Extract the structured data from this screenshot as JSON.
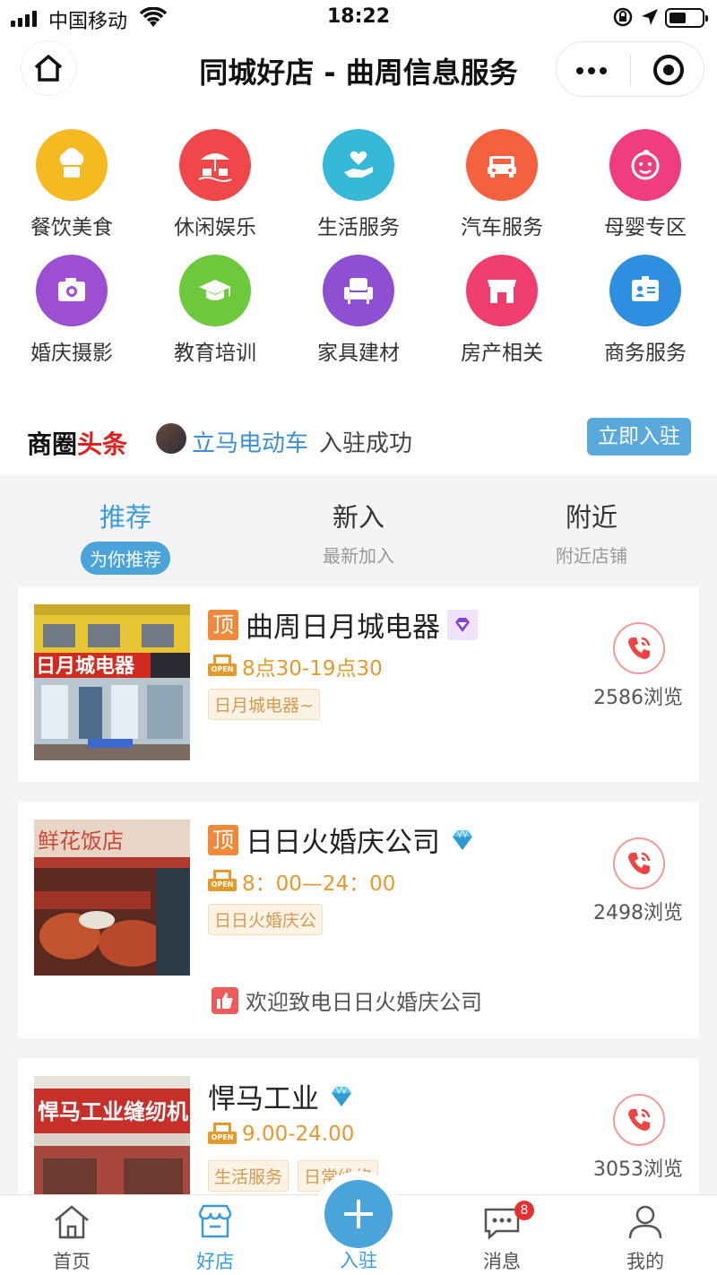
{
  "status_bar": {
    "carrier": "中国移动",
    "time": "18:22"
  },
  "nav": {
    "title": "同城好店 - 曲周信息服务"
  },
  "categories": [
    {
      "label": "餐饮美食",
      "icon": "chef-hat-icon",
      "color": "#f5b921"
    },
    {
      "label": "休闲娱乐",
      "icon": "beach-umbrella-icon",
      "color": "#f0474b"
    },
    {
      "label": "生活服务",
      "icon": "heart-hand-icon",
      "color": "#36b8d8"
    },
    {
      "label": "汽车服务",
      "icon": "car-icon",
      "color": "#f5603e"
    },
    {
      "label": "母婴专区",
      "icon": "baby-face-icon",
      "color": "#ef3d7d"
    },
    {
      "label": "婚庆摄影",
      "icon": "camera-icon",
      "color": "#9c4fd0"
    },
    {
      "label": "教育培训",
      "icon": "graduation-cap-icon",
      "color": "#6cc93b"
    },
    {
      "label": "家具建材",
      "icon": "armchair-icon",
      "color": "#8e4fd0"
    },
    {
      "label": "房产相关",
      "icon": "storefront-icon",
      "color": "#ef3d6d"
    },
    {
      "label": "商务服务",
      "icon": "id-card-icon",
      "color": "#2e8fe0"
    }
  ],
  "headline": {
    "title_part1": "商圈",
    "title_part2": "头条",
    "store_name": "立马电动车",
    "suffix": "入驻成功",
    "join_button": "立即入驻"
  },
  "tabs": [
    {
      "label": "推荐",
      "sub": "为你推荐",
      "active": true
    },
    {
      "label": "新入",
      "sub": "最新加入",
      "active": false
    },
    {
      "label": "附近",
      "sub": "附近店铺",
      "active": false
    }
  ],
  "stores": [
    {
      "top_badge": "顶",
      "name": "曲周日月城电器",
      "hours": "8点30-19点30",
      "tags": [
        "日月城电器~"
      ],
      "views": "2586浏览",
      "badge_icon": "purple-diamond-icon"
    },
    {
      "top_badge": "顶",
      "name": "日日火婚庆公司",
      "hours": "8：00—24：00",
      "tags": [
        "日日火婚庆公"
      ],
      "views": "2498浏览",
      "promo": "欢迎致电日日火婚庆公司",
      "badge_icon": "blue-diamond-icon"
    },
    {
      "name": "悍马工业",
      "hours": "9.00-24.00",
      "tags": [
        "生活服务",
        "日常维修"
      ],
      "views": "3053浏览",
      "badge_icon": "blue-diamond-icon"
    }
  ],
  "open_tag": "OPEN",
  "tabbar": [
    {
      "label": "首页",
      "icon": "home-icon",
      "active": false
    },
    {
      "label": "好店",
      "icon": "shop-icon",
      "active": true
    },
    {
      "label": "入驻",
      "icon": "plus-icon",
      "active": false
    },
    {
      "label": "消息",
      "icon": "message-icon",
      "active": false,
      "badge": "8"
    },
    {
      "label": "我的",
      "icon": "user-icon",
      "active": false
    }
  ],
  "colors": {
    "accent": "#4aa3d9",
    "highlight_red": "#e02020",
    "hours_orange": "#e39a2c"
  }
}
